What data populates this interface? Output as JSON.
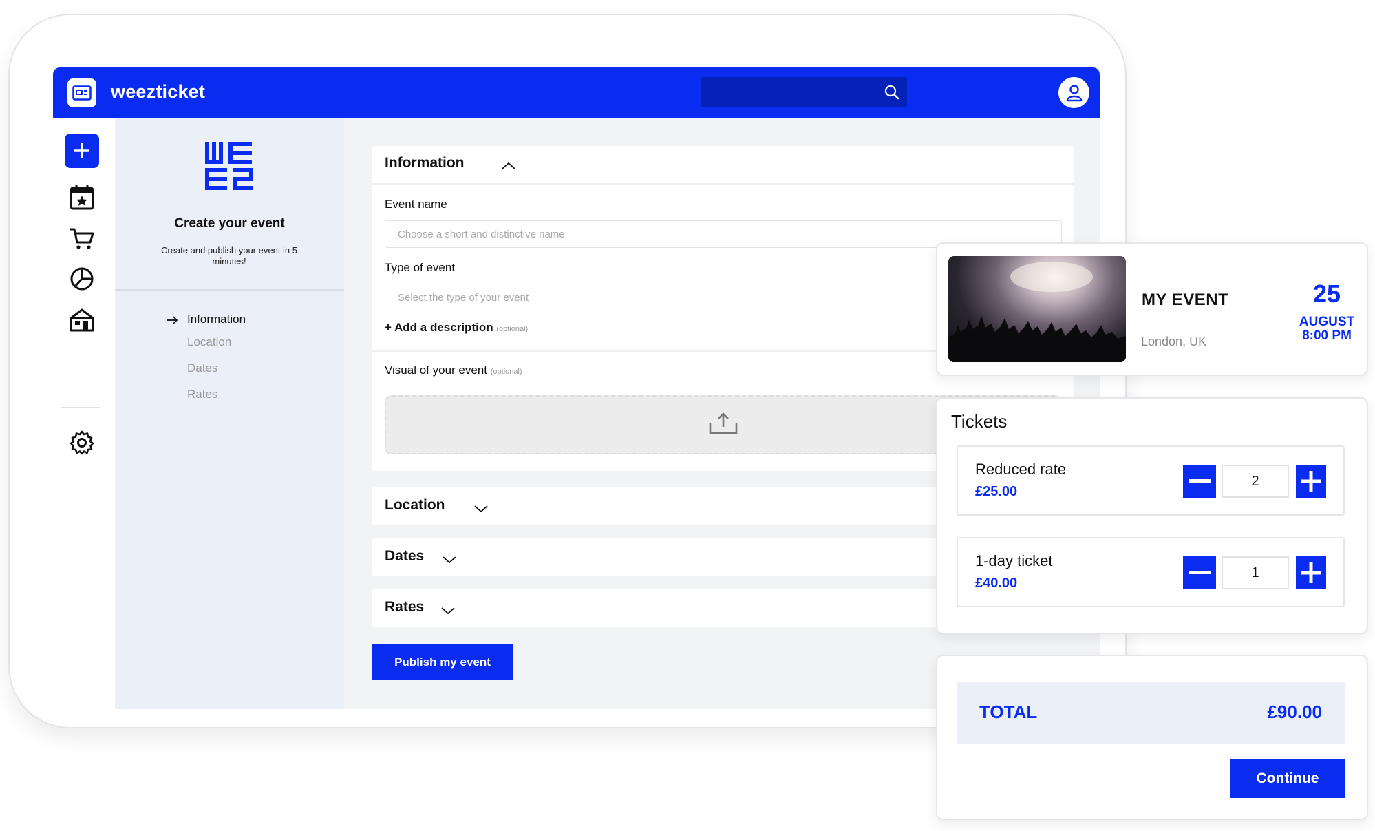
{
  "app": {
    "brand": "weezticket",
    "search_value": ""
  },
  "colors": {
    "accent": "#0a2cf0",
    "panel": "#ebeff7",
    "background": "#f2f3f5"
  },
  "rail": {
    "icons": [
      "plus-icon",
      "calendar-star-icon",
      "cart-icon",
      "pie-chart-icon",
      "store-icon",
      "gear-icon"
    ]
  },
  "steps_panel": {
    "title": "Create your event",
    "subtitle": "Create and publish your event in 5 minutes!",
    "steps": [
      {
        "label": "Information",
        "active": true
      },
      {
        "label": "Location",
        "active": false
      },
      {
        "label": "Dates",
        "active": false
      },
      {
        "label": "Rates",
        "active": false
      }
    ]
  },
  "form": {
    "information": {
      "title": "Information",
      "event_name_label": "Event name",
      "event_name_placeholder": "Choose a short and distinctive name",
      "event_type_label": "Type of event",
      "event_type_placeholder": "Select the type of your event",
      "add_description": "+ Add a description",
      "optional": "(optional)",
      "visual_label": "Visual of your event"
    },
    "sections": [
      {
        "title": "Location"
      },
      {
        "title": "Dates"
      },
      {
        "title": "Rates"
      }
    ],
    "publish_label": "Publish my event"
  },
  "event_card": {
    "name": "MY EVENT",
    "location": "London, UK",
    "day": "25",
    "month": "AUGUST",
    "time": "8:00 PM"
  },
  "tickets": {
    "title": "Tickets",
    "items": [
      {
        "name": "Reduced rate",
        "price": "£25.00",
        "qty": "2"
      },
      {
        "name": "1-day ticket",
        "price": "£40.00",
        "qty": "1"
      }
    ]
  },
  "summary": {
    "total_label": "TOTAL",
    "total_value": "£90.00",
    "continue_label": "Continue"
  }
}
